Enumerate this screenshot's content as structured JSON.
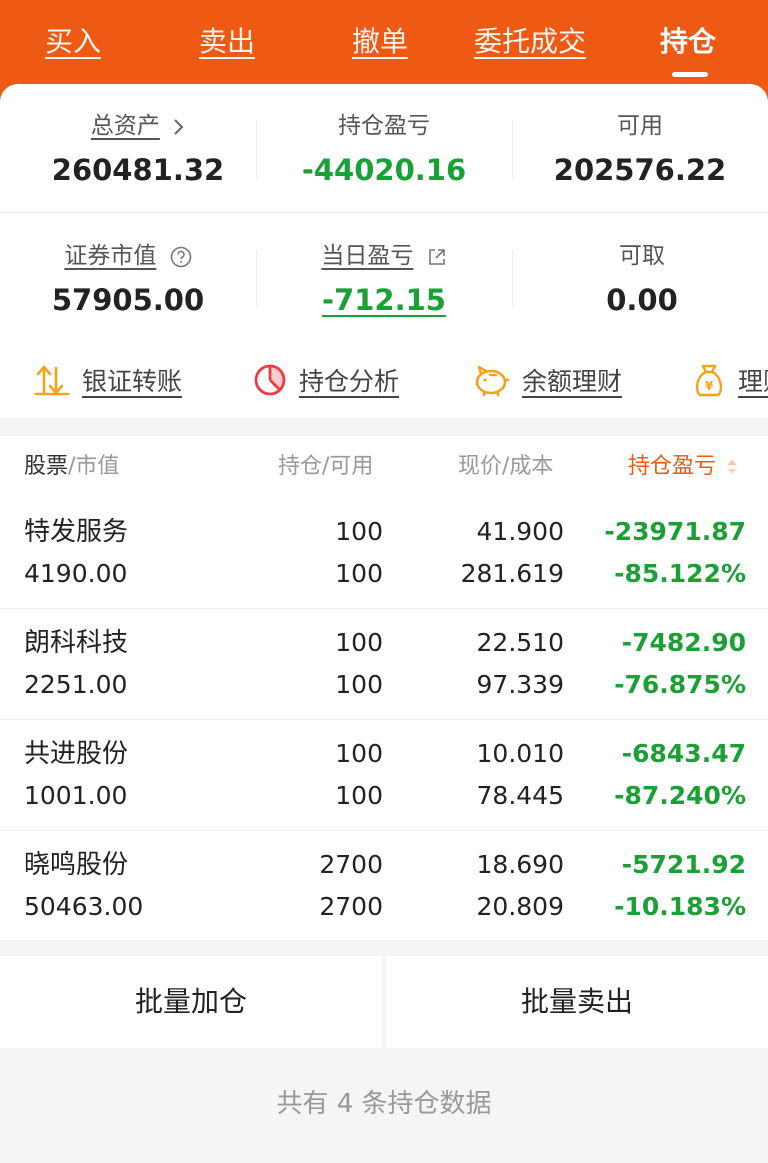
{
  "tabs": [
    {
      "label": "买入"
    },
    {
      "label": "卖出"
    },
    {
      "label": "撤单"
    },
    {
      "label": "委托成交"
    },
    {
      "label": "持仓"
    }
  ],
  "summary": {
    "total_assets": {
      "label": "总资产",
      "value": "260481.32"
    },
    "position_pnl": {
      "label": "持仓盈亏",
      "value": "-44020.16"
    },
    "available": {
      "label": "可用",
      "value": "202576.22"
    },
    "market_value": {
      "label": "证券市值",
      "value": "57905.00"
    },
    "daily_pnl": {
      "label": "当日盈亏",
      "value": "-712.15"
    },
    "withdrawable": {
      "label": "可取",
      "value": "0.00"
    }
  },
  "quick_actions": [
    {
      "label": "银证转账",
      "icon": "transfer-icon"
    },
    {
      "label": "持仓分析",
      "icon": "pie-chart-icon"
    },
    {
      "label": "余额理财",
      "icon": "piggy-bank-icon"
    },
    {
      "label": "理财",
      "icon": "money-bag-icon"
    }
  ],
  "table": {
    "headers": {
      "stock": "股票",
      "market_value": "/市值",
      "position": "持仓/可用",
      "price": "现价/成本",
      "pnl": "持仓盈亏"
    },
    "rows": [
      {
        "name": "特发服务",
        "value": "4190.00",
        "position": "100",
        "available": "100",
        "price": "41.900",
        "cost": "281.619",
        "pnl": "-23971.87",
        "pnl_pct": "-85.122%"
      },
      {
        "name": "朗科科技",
        "value": "2251.00",
        "position": "100",
        "available": "100",
        "price": "22.510",
        "cost": "97.339",
        "pnl": "-7482.90",
        "pnl_pct": "-76.875%"
      },
      {
        "name": "共进股份",
        "value": "1001.00",
        "position": "100",
        "available": "100",
        "price": "10.010",
        "cost": "78.445",
        "pnl": "-6843.47",
        "pnl_pct": "-87.240%"
      },
      {
        "name": "晓鸣股份",
        "value": "50463.00",
        "position": "2700",
        "available": "2700",
        "price": "18.690",
        "cost": "20.809",
        "pnl": "-5721.92",
        "pnl_pct": "-10.183%"
      }
    ]
  },
  "batch": {
    "add_label": "批量加仓",
    "sell_label": "批量卖出"
  },
  "footer": {
    "text": "共有 4 条持仓数据"
  },
  "colors": {
    "brand_orange": "#ee5a14",
    "loss_green": "#1aa034"
  }
}
